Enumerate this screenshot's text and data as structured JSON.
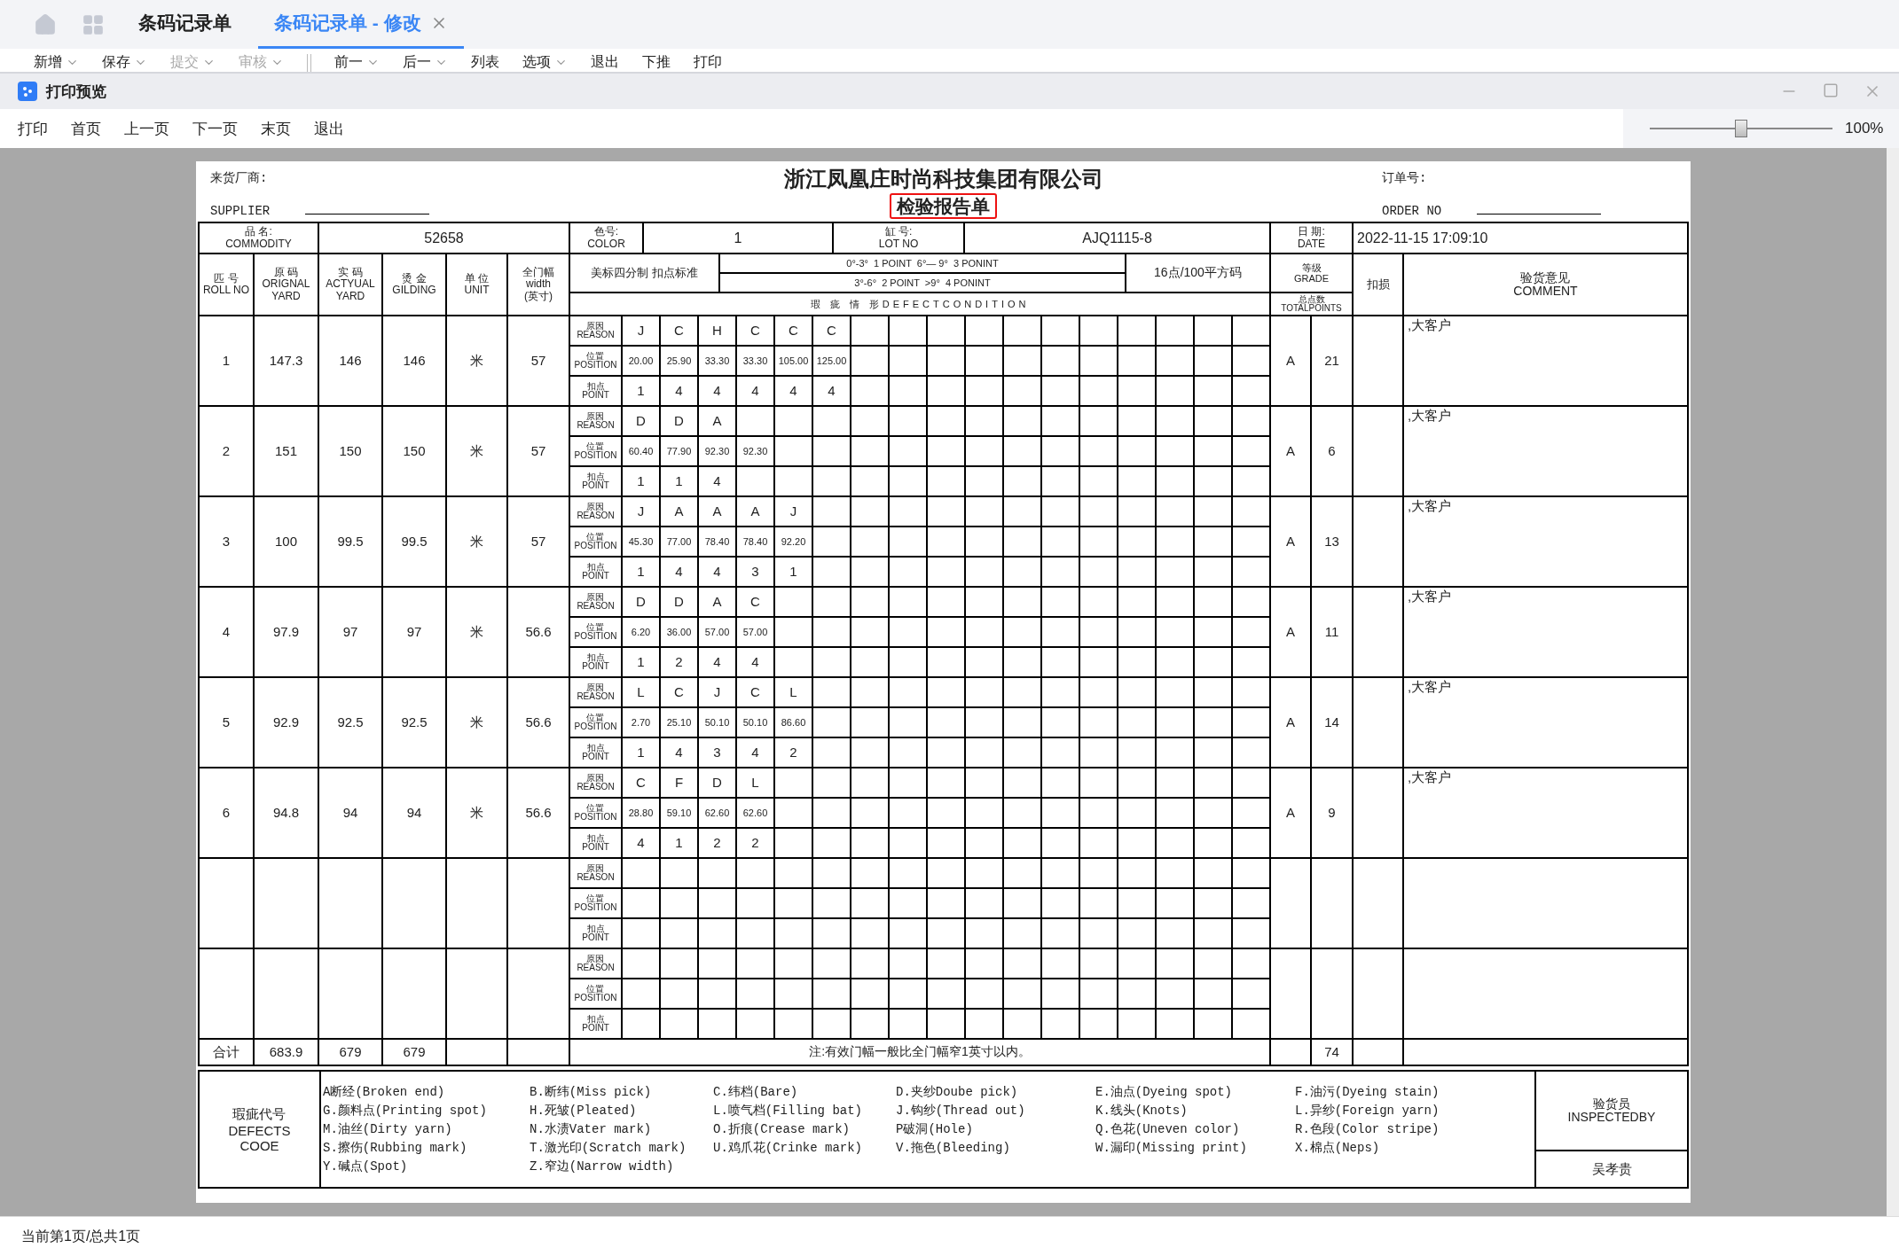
{
  "tabs": [
    {
      "label": "条码记录单",
      "selected": false,
      "closable": false
    },
    {
      "label": "条码记录单 - 修改",
      "selected": true,
      "closable": true
    }
  ],
  "menu": [
    {
      "label": "新增",
      "dropdown": true,
      "disabled": false
    },
    {
      "label": "保存",
      "dropdown": true,
      "disabled": false
    },
    {
      "label": "提交",
      "dropdown": true,
      "disabled": true
    },
    {
      "label": "审核",
      "dropdown": true,
      "disabled": true,
      "divider_after": true
    },
    {
      "label": "前一",
      "dropdown": true,
      "disabled": false
    },
    {
      "label": "后一",
      "dropdown": true,
      "disabled": false
    },
    {
      "label": "列表",
      "dropdown": false,
      "disabled": false
    },
    {
      "label": "选项",
      "dropdown": true,
      "disabled": false
    },
    {
      "label": "退出",
      "dropdown": false,
      "disabled": false
    },
    {
      "label": "下推",
      "dropdown": false,
      "disabled": false
    },
    {
      "label": "打印",
      "dropdown": false,
      "disabled": false
    }
  ],
  "dialog": {
    "title": "打印预览",
    "toolbar": [
      "打印",
      "首页",
      "上一页",
      "下一页",
      "末页",
      "退出"
    ],
    "zoom": {
      "level": 0.5,
      "reading": "100%"
    },
    "status": "当前第1页/总共1页"
  },
  "report": {
    "supplier_label": "来货厂商:",
    "supplier_en": "SUPPLIER",
    "company": "浙江凤凰庄时尚科技集团有限公司",
    "title": "检验报告单",
    "title_highlighted": true,
    "order_label": "订单号:",
    "order_en": "ORDER NO",
    "header": [
      {
        "kind": "label",
        "text": "品 名:\nCOMMODITY"
      },
      {
        "kind": "value",
        "text": "52658"
      },
      {
        "kind": "label",
        "text": "色号:\nCOLOR"
      },
      {
        "kind": "value",
        "text": "1"
      },
      {
        "kind": "label",
        "text": "缸 号:\nLOT NO"
      },
      {
        "kind": "value",
        "text": "AJQ1115-8"
      },
      {
        "kind": "label",
        "text": "日 期:\nDATE"
      },
      {
        "kind": "date",
        "text": "2022-11-15 17:09:10"
      }
    ],
    "columns": [
      "匹 号\nROLL NO",
      "原 码\nORIGNAL\nYARD",
      "实 码\nACTYUAL\nYARD",
      "烫 金\nGILDING",
      "单 位\nUNIT",
      "全门幅\nwidth\n(英寸)"
    ],
    "standard": {
      "label": "美标四分制 扣点标准",
      "lines": [
        "0°-3°  1 POINT  6°— 9°  3 PONINT",
        "3°-6°  2 POINT  >9°  4 PONINT"
      ],
      "density": "16点/100平方码",
      "condition": "瑕 疵 情 形DEFECTCONDITION"
    },
    "grade": "等级\nGRADE",
    "total_points": "总点数\nTOTALPOINTS",
    "deduction": "扣损",
    "comment": "验货意见\nCOMMENT",
    "rows": [
      {
        "kind": "entry",
        "cells": [
          "1",
          "147.3",
          "146",
          "146",
          "米",
          "57"
        ],
        "labels": [
          "原因\nREASON",
          "位置\nPOSITION",
          "扣点\nPOINT"
        ],
        "reasons": [
          "J",
          "C",
          "H",
          "C",
          "C",
          "C"
        ],
        "positions": [
          "20.00",
          "25.90",
          "33.30",
          "33.30",
          "105.00",
          "125.00"
        ],
        "points": [
          "1",
          "4",
          "4",
          "4",
          "4",
          "4"
        ],
        "grade": "A",
        "total": "21",
        "comment": ",大客户"
      },
      {
        "kind": "entry",
        "cells": [
          "2",
          "151",
          "150",
          "150",
          "米",
          "57"
        ],
        "labels": [
          "原因\nREASON",
          "位置\nPOSITION",
          "扣点\nPOINT"
        ],
        "reasons": [
          "D",
          "D",
          "A"
        ],
        "positions": [
          "60.40",
          "77.90",
          "92.30",
          "92.30"
        ],
        "points": [
          "1",
          "1",
          "4"
        ],
        "grade": "A",
        "total": "6",
        "comment": ",大客户"
      },
      {
        "kind": "entry",
        "cells": [
          "3",
          "100",
          "99.5",
          "99.5",
          "米",
          "57"
        ],
        "labels": [
          "原因\nREASON",
          "位置\nPOSITION",
          "扣点\nPOINT"
        ],
        "reasons": [
          "J",
          "A",
          "A",
          "A",
          "J"
        ],
        "positions": [
          "45.30",
          "77.00",
          "78.40",
          "78.40",
          "92.20"
        ],
        "points": [
          "1",
          "4",
          "4",
          "3",
          "1"
        ],
        "grade": "A",
        "total": "13",
        "comment": ",大客户"
      },
      {
        "kind": "entry",
        "cells": [
          "4",
          "97.9",
          "97",
          "97",
          "米",
          "56.6"
        ],
        "labels": [
          "原因\nREASON",
          "位置\nPOSITION",
          "扣点\nPOINT"
        ],
        "reasons": [
          "D",
          "D",
          "A",
          "C"
        ],
        "positions": [
          "6.20",
          "36.00",
          "57.00",
          "57.00"
        ],
        "points": [
          "1",
          "2",
          "4",
          "4"
        ],
        "grade": "A",
        "total": "11",
        "comment": ",大客户"
      },
      {
        "kind": "entry",
        "cells": [
          "5",
          "92.9",
          "92.5",
          "92.5",
          "米",
          "56.6"
        ],
        "labels": [
          "原因\nREASON",
          "位置\nPOSITION",
          "扣点\nPOINT"
        ],
        "reasons": [
          "L",
          "C",
          "J",
          "C",
          "L"
        ],
        "positions": [
          "2.70",
          "25.10",
          "50.10",
          "50.10",
          "86.60"
        ],
        "points": [
          "1",
          "4",
          "3",
          "4",
          "2"
        ],
        "grade": "A",
        "total": "14",
        "comment": ",大客户"
      },
      {
        "kind": "entry",
        "cells": [
          "6",
          "94.8",
          "94",
          "94",
          "米",
          "56.6"
        ],
        "labels": [
          "原因\nREASON",
          "位置\nPOSITION",
          "扣点\nPOINT"
        ],
        "reasons": [
          "C",
          "F",
          "D",
          "L"
        ],
        "positions": [
          "28.80",
          "59.10",
          "62.60",
          "62.60"
        ],
        "points": [
          "4",
          "1",
          "2",
          "2"
        ],
        "grade": "A",
        "total": "9",
        "comment": ",大客户"
      },
      {
        "kind": "blank",
        "labels": [
          "原因\nREASON",
          "位置\nPOSITION",
          "扣点\nPOINT"
        ]
      },
      {
        "kind": "blank",
        "labels": [
          "原因\nREASON",
          "位置\nPOSITION",
          "扣点\nPOINT"
        ]
      }
    ],
    "totals": {
      "label": "合计",
      "cells": [
        "683.9",
        "679",
        "679"
      ],
      "note": "注:有效门幅一般比全门幅窄1英寸以内。",
      "total": "74"
    },
    "legend": {
      "title": "瑕疵代号\nDEFECTS\nCOOE",
      "codes": [
        "A断经(Broken end)",
        "B.断纬(Miss pick)",
        "C.纬档(Bare)",
        "D.夹纱Doube pick)",
        "E.油点(Dyeing spot)",
        "F.油污(Dyeing stain)",
        "G.颜料点(Printing spot)",
        "H.死皱(Pleated)",
        "L.喷气档(Filling bat)",
        "J.钩纱(Thread out)",
        "K.线头(Knots)",
        "L.异纱(Foreign yarn)",
        "M.油丝(Dirty yarn)",
        "N.水渍Vater mark)",
        "O.折痕(Crease mark)",
        "P破洞(Hole)",
        "Q.色花(Uneven color)",
        "R.色段(Color stripe)",
        "S.擦伤(Rubbing mark)",
        "T.激光印(Scratch mark)",
        "U.鸡爪花(Crinke mark)",
        "V.拖色(Bleeding)",
        "W.漏印(Missing print)",
        "X.棉点(Neps)",
        "Y.碱点(Spot)",
        "Z.窄边(Narrow width)"
      ],
      "inspector_label": "验货员\nINSPECTEDBY",
      "inspector": "吴孝贵"
    }
  }
}
